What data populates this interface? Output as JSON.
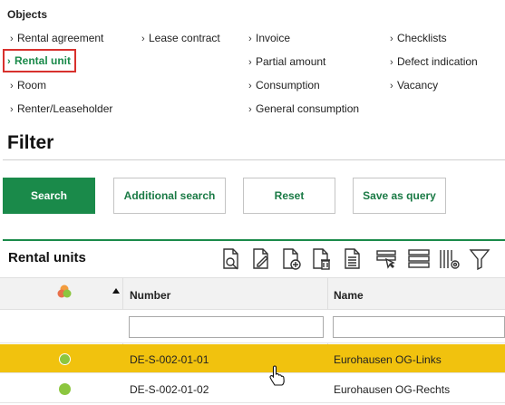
{
  "objects": {
    "title": "Objects",
    "links": {
      "rental_agreement": "Rental agreement",
      "lease_contract": "Lease contract",
      "invoice": "Invoice",
      "checklists": "Checklists",
      "rental_unit": "Rental unit",
      "partial_amount": "Partial amount",
      "defect_indication": "Defect indication",
      "room": "Room",
      "consumption": "Consumption",
      "vacancy": "Vacancy",
      "renter_leaseholder": "Renter/Leaseholder",
      "general_consumption": "General consumption"
    },
    "chevron": "›"
  },
  "filter": {
    "title": "Filter",
    "buttons": {
      "search": "Search",
      "additional_search": "Additional search",
      "reset": "Reset",
      "save_as_query": "Save as query"
    }
  },
  "grid": {
    "title": "Rental units",
    "columns": {
      "number": "Number",
      "name": "Name"
    },
    "filters": {
      "number": "",
      "name": ""
    },
    "rows": [
      {
        "number": "DE-S-002-01-01",
        "name": "Eurohausen OG-Links",
        "status_color": "#8cc63f",
        "selected": true
      },
      {
        "number": "DE-S-002-01-02",
        "name": "Eurohausen OG-Rechts",
        "status_color": "#8cc63f",
        "selected": false
      }
    ],
    "toolbar_icons": [
      "document-search-icon",
      "document-edit-icon",
      "document-add-icon",
      "document-delete-icon",
      "document-text-icon",
      "table-select-icon",
      "table-rows-icon",
      "column-settings-icon",
      "filter-funnel-icon"
    ]
  },
  "colors": {
    "accent": "#1a8a4a",
    "highlight": "#d8312d",
    "selected_row": "#f1c20e"
  }
}
